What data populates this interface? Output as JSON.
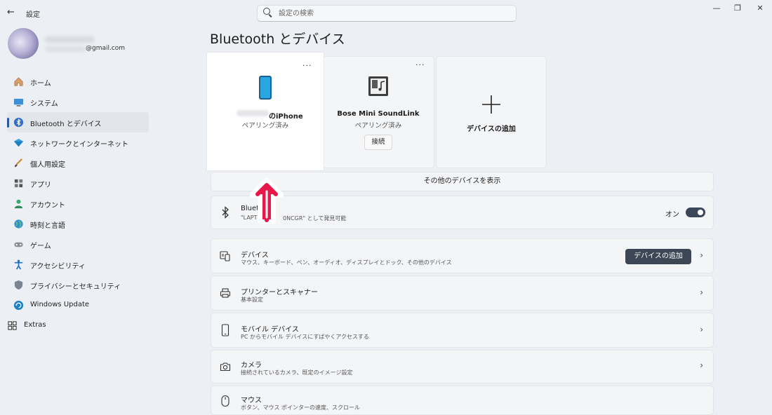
{
  "window": {
    "app_title": "設定",
    "min_glyph": "—",
    "max_glyph": "❐",
    "close_glyph": "✕"
  },
  "search": {
    "placeholder": "設定の検索"
  },
  "profile": {
    "email": "@gmail.com"
  },
  "nav": {
    "items": [
      {
        "label": "ホーム",
        "icon": "home-icon"
      },
      {
        "label": "システム",
        "icon": "system-icon"
      },
      {
        "label": "Bluetooth とデバイス",
        "icon": "bluetooth-icon",
        "selected": true
      },
      {
        "label": "ネットワークとインターネット",
        "icon": "network-icon"
      },
      {
        "label": "個人用設定",
        "icon": "brush-icon"
      },
      {
        "label": "アプリ",
        "icon": "apps-icon"
      },
      {
        "label": "アカウント",
        "icon": "account-icon"
      },
      {
        "label": "時刻と言語",
        "icon": "globe-icon"
      },
      {
        "label": "ゲーム",
        "icon": "gamepad-icon"
      },
      {
        "label": "アクセシビリティ",
        "icon": "accessibility-icon"
      },
      {
        "label": "プライバシーとセキュリティ",
        "icon": "shield-icon"
      },
      {
        "label": "Windows Update",
        "icon": "update-icon"
      },
      {
        "label": "Extras",
        "icon": "extras-icon"
      }
    ]
  },
  "page": {
    "title": "Bluetooth とデバイス"
  },
  "device_cards": {
    "iphone": {
      "name": "のiPhone",
      "status": "ペアリング済み",
      "more": "···"
    },
    "bose": {
      "name": "Bose Mini SoundLink",
      "status": "ペアリング済み",
      "action": "接続",
      "more": "···"
    },
    "add": {
      "label": "デバイスの追加"
    }
  },
  "show_more": "その他のデバイスを表示",
  "bluetooth_row": {
    "title_fragment": "Blueto",
    "subtitle_left": "\"LAPTO",
    "subtitle_right": "0NCGR\" として発見可能",
    "toggle_label": "オン",
    "toggle_on": true
  },
  "rows": [
    {
      "title": "デバイス",
      "subtitle": "マウス、キーボード、ペン、オーディオ、ディスプレイとドック、その他のデバイス",
      "button": "デバイスの追加",
      "icon": "devices-icon"
    },
    {
      "title": "プリンターとスキャナー",
      "subtitle": "基本設定",
      "icon": "printer-icon"
    },
    {
      "title": "モバイル デバイス",
      "subtitle": "PC からモバイル デバイスにすばやくアクセスする",
      "icon": "phone-icon"
    },
    {
      "title": "カメラ",
      "subtitle": "接続されているカメラ、既定のイメージ設定",
      "icon": "camera-icon"
    },
    {
      "title": "マウス",
      "subtitle": "ボタン、マウス ポインターの速度、スクロール",
      "icon": "mouse-icon"
    }
  ],
  "colors": {
    "accent": "#2c5a9e",
    "annotation_arrow": "#e8194a",
    "toggle_on": "#3a4758"
  }
}
